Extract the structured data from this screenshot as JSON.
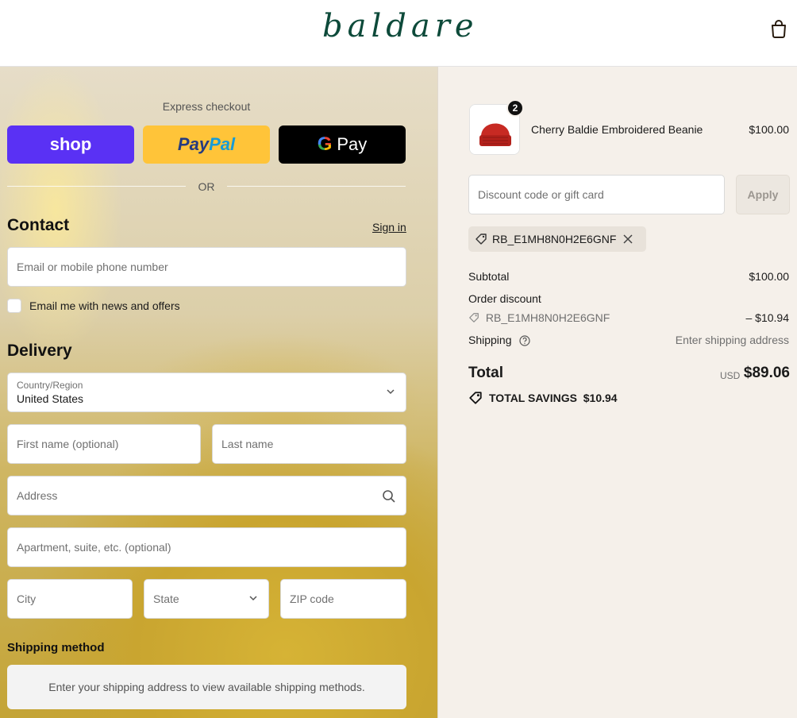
{
  "header": {
    "logo": "baldare",
    "cart_icon": "shopping-bag-icon"
  },
  "express": {
    "title": "Express checkout",
    "shop_label": "shop",
    "paypal_part1": "Pay",
    "paypal_part2": "Pal",
    "gpay_g": "G",
    "gpay_label": "Pay",
    "or": "OR"
  },
  "contact": {
    "title": "Contact",
    "sign_in": "Sign in",
    "email_placeholder": "Email or mobile phone number",
    "newsletter_label": "Email me with news and offers"
  },
  "delivery": {
    "title": "Delivery",
    "country_label": "Country/Region",
    "country_value": "United States",
    "first_name_placeholder": "First name (optional)",
    "last_name_placeholder": "Last name",
    "address_placeholder": "Address",
    "apartment_placeholder": "Apartment, suite, etc. (optional)",
    "city_placeholder": "City",
    "state_placeholder": "State",
    "zip_placeholder": "ZIP code"
  },
  "shipping_method": {
    "title": "Shipping method",
    "note": "Enter your shipping address to view available shipping methods."
  },
  "order": {
    "item": {
      "name": "Cherry Baldie Embroidered Beanie",
      "price": "$100.00",
      "quantity": "2"
    },
    "discount_placeholder": "Discount code or gift card",
    "apply_label": "Apply",
    "applied_code": "RB_E1MH8N0H2E6GNF",
    "subtotal_label": "Subtotal",
    "subtotal_value": "$100.00",
    "order_discount_label": "Order discount",
    "discount_code": "RB_E1MH8N0H2E6GNF",
    "discount_value": "– $10.94",
    "shipping_label": "Shipping",
    "shipping_value": "Enter shipping address",
    "total_label": "Total",
    "total_currency": "USD",
    "total_value": "$89.06",
    "savings_label": "TOTAL SAVINGS",
    "savings_value": "$10.94"
  },
  "colors": {
    "shop_pay": "#5a31f4",
    "paypal": "#ffc439",
    "gpay": "#000000",
    "brand": "#0d4a3a",
    "summary_bg": "#f5f0ea"
  }
}
